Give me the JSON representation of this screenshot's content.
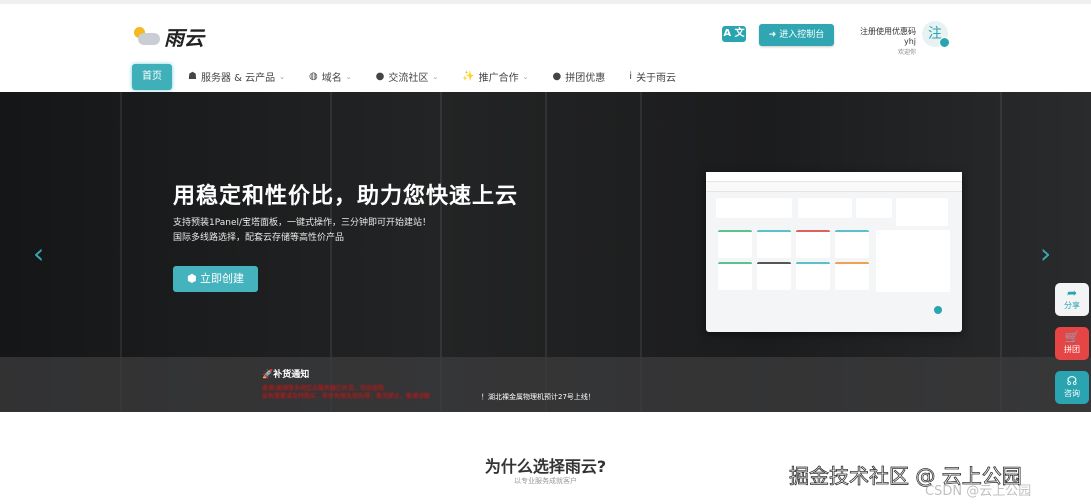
{
  "brand": {
    "name": "雨云"
  },
  "header": {
    "translate_label": "A 文",
    "console_button": "进入控制台",
    "user_name": "注册使用优惠码yhj",
    "user_greeting": "欢迎你",
    "avatar_char": "注"
  },
  "nav": [
    {
      "label": "首页"
    },
    {
      "label": "服务器 & 云产品"
    },
    {
      "label": "域名"
    },
    {
      "label": "交流社区"
    },
    {
      "label": "推广合作"
    },
    {
      "label": "拼团优惠"
    },
    {
      "label": "关于雨云"
    }
  ],
  "hero": {
    "title": "用稳定和性价比，助力您快速上云",
    "sub1": "支持预装1Panel/宝塔面板，一键式操作，三分钟即可开始建站！",
    "sub2": "国际多线路选择，配套云存储等高性价产品",
    "cta": "立即创建"
  },
  "notice": {
    "title": "补货通知",
    "red1": "香港/美国等多地区云服务器已补货，欢迎选购",
    "red2": "如有需要请及时购买，库存有限先到先得，售完即止，敬请谅解",
    "white": "！湖北裸金属物理机预计27号上线！"
  },
  "side": {
    "share": "分享",
    "group": "拼团",
    "consult": "咨询"
  },
  "why": {
    "title": "为什么选择雨云?",
    "subtitle": "以专业服务成就客户"
  },
  "watermark": {
    "main": "掘金技术社区 @ 云上公园",
    "csdn": "CSDN @云上公园"
  },
  "colors": {
    "accent": "#2fa6b1",
    "group_red": "#e64545"
  }
}
